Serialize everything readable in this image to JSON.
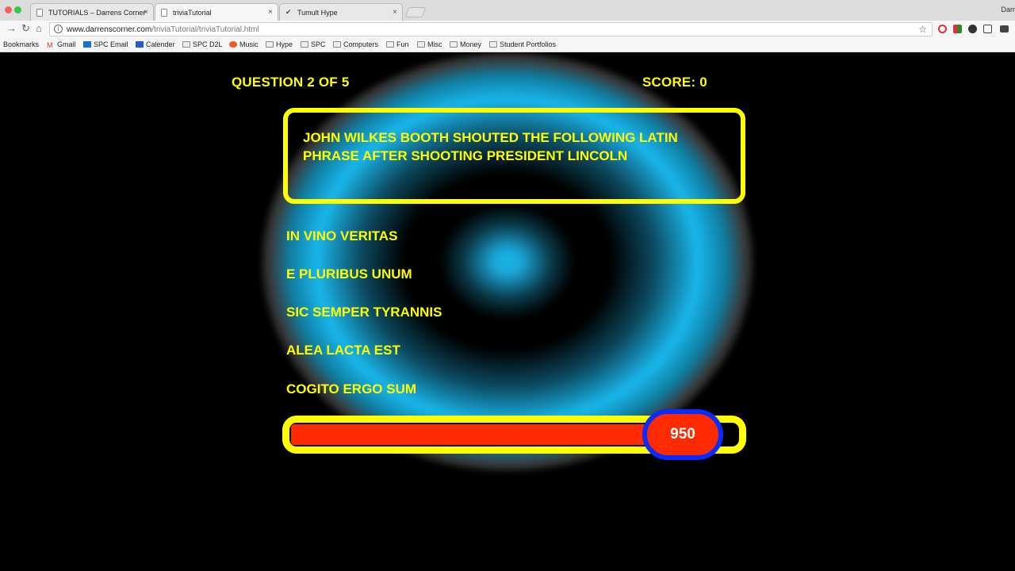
{
  "browser": {
    "tabs": [
      {
        "label": "TUTORIALS – Darrens Corner"
      },
      {
        "label": "triviaTutorial"
      },
      {
        "label": "Tumult Hype"
      }
    ],
    "profile_name": "Darr",
    "url_domain": "www.darrenscorner.com",
    "url_path": "/triviaTutorial/triviaTutorial.html",
    "bookmarks": [
      "Bookmarks",
      "Gmail",
      "SPC Email",
      "Calender",
      "SPC D2L",
      "Music",
      "Hype",
      "SPC",
      "Computers",
      "Fun",
      "Misc",
      "Money",
      "Student Portfolios"
    ]
  },
  "game": {
    "question_counter": "QUESTION 2 OF 5",
    "score": "SCORE: 0",
    "question": "JOHN WILKES BOOTH SHOUTED THE FOLLOWING LATIN PHRASE AFTER SHOOTING PRESIDENT LINCOLN",
    "answers": [
      "IN VINO VERITAS",
      "E PLURIBUS UNUM",
      "SIC SEMPER TYRANNIS",
      "ALEA LACTA EST",
      "COGITO ERGO SUM"
    ],
    "timer_value": "950",
    "timer_fraction": 0.95
  },
  "colors": {
    "accent_yellow": "#ffff00",
    "timer_red": "#ff2a00",
    "badge_blue": "#0a2aff",
    "glow_cyan": "#19b7ec"
  }
}
